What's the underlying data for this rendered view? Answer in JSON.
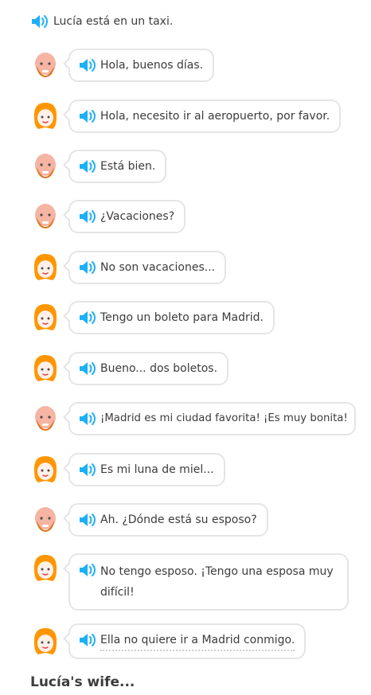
{
  "narration": "Lucía está en un taxi.",
  "lines": [
    {
      "speaker": "man",
      "text": "Hola, buenos días."
    },
    {
      "speaker": "woman",
      "text": "Hola, necesito ir al aeropuerto, por favor."
    },
    {
      "speaker": "man",
      "text": "Está bien."
    },
    {
      "speaker": "man",
      "text": "¿Vacaciones?"
    },
    {
      "speaker": "woman",
      "text": "No son vacaciones..."
    },
    {
      "speaker": "woman",
      "text": "Tengo un boleto para Madrid."
    },
    {
      "speaker": "woman",
      "text": "Bueno... dos boletos."
    },
    {
      "speaker": "man",
      "text": "¡Madrid es mi ciudad favorita! ¡Es muy bonita!"
    },
    {
      "speaker": "woman",
      "text": "Es mi luna de miel..."
    },
    {
      "speaker": "man",
      "text": "Ah. ¿Dónde está su esposo?"
    },
    {
      "speaker": "woman",
      "text": "No tengo esposo. ¡Tengo una esposa muy difícil!"
    },
    {
      "speaker": "woman",
      "text": "Ella no quiere ir a Madrid conmigo."
    }
  ],
  "question_title": "Lucía's wife...",
  "colors": {
    "speaker_icon": "#1cb0f6",
    "bubble_border": "#e5e5e5",
    "woman_hair": "#ff9600",
    "man_skin": "#f6b4a3",
    "beard": "#e0761e"
  }
}
